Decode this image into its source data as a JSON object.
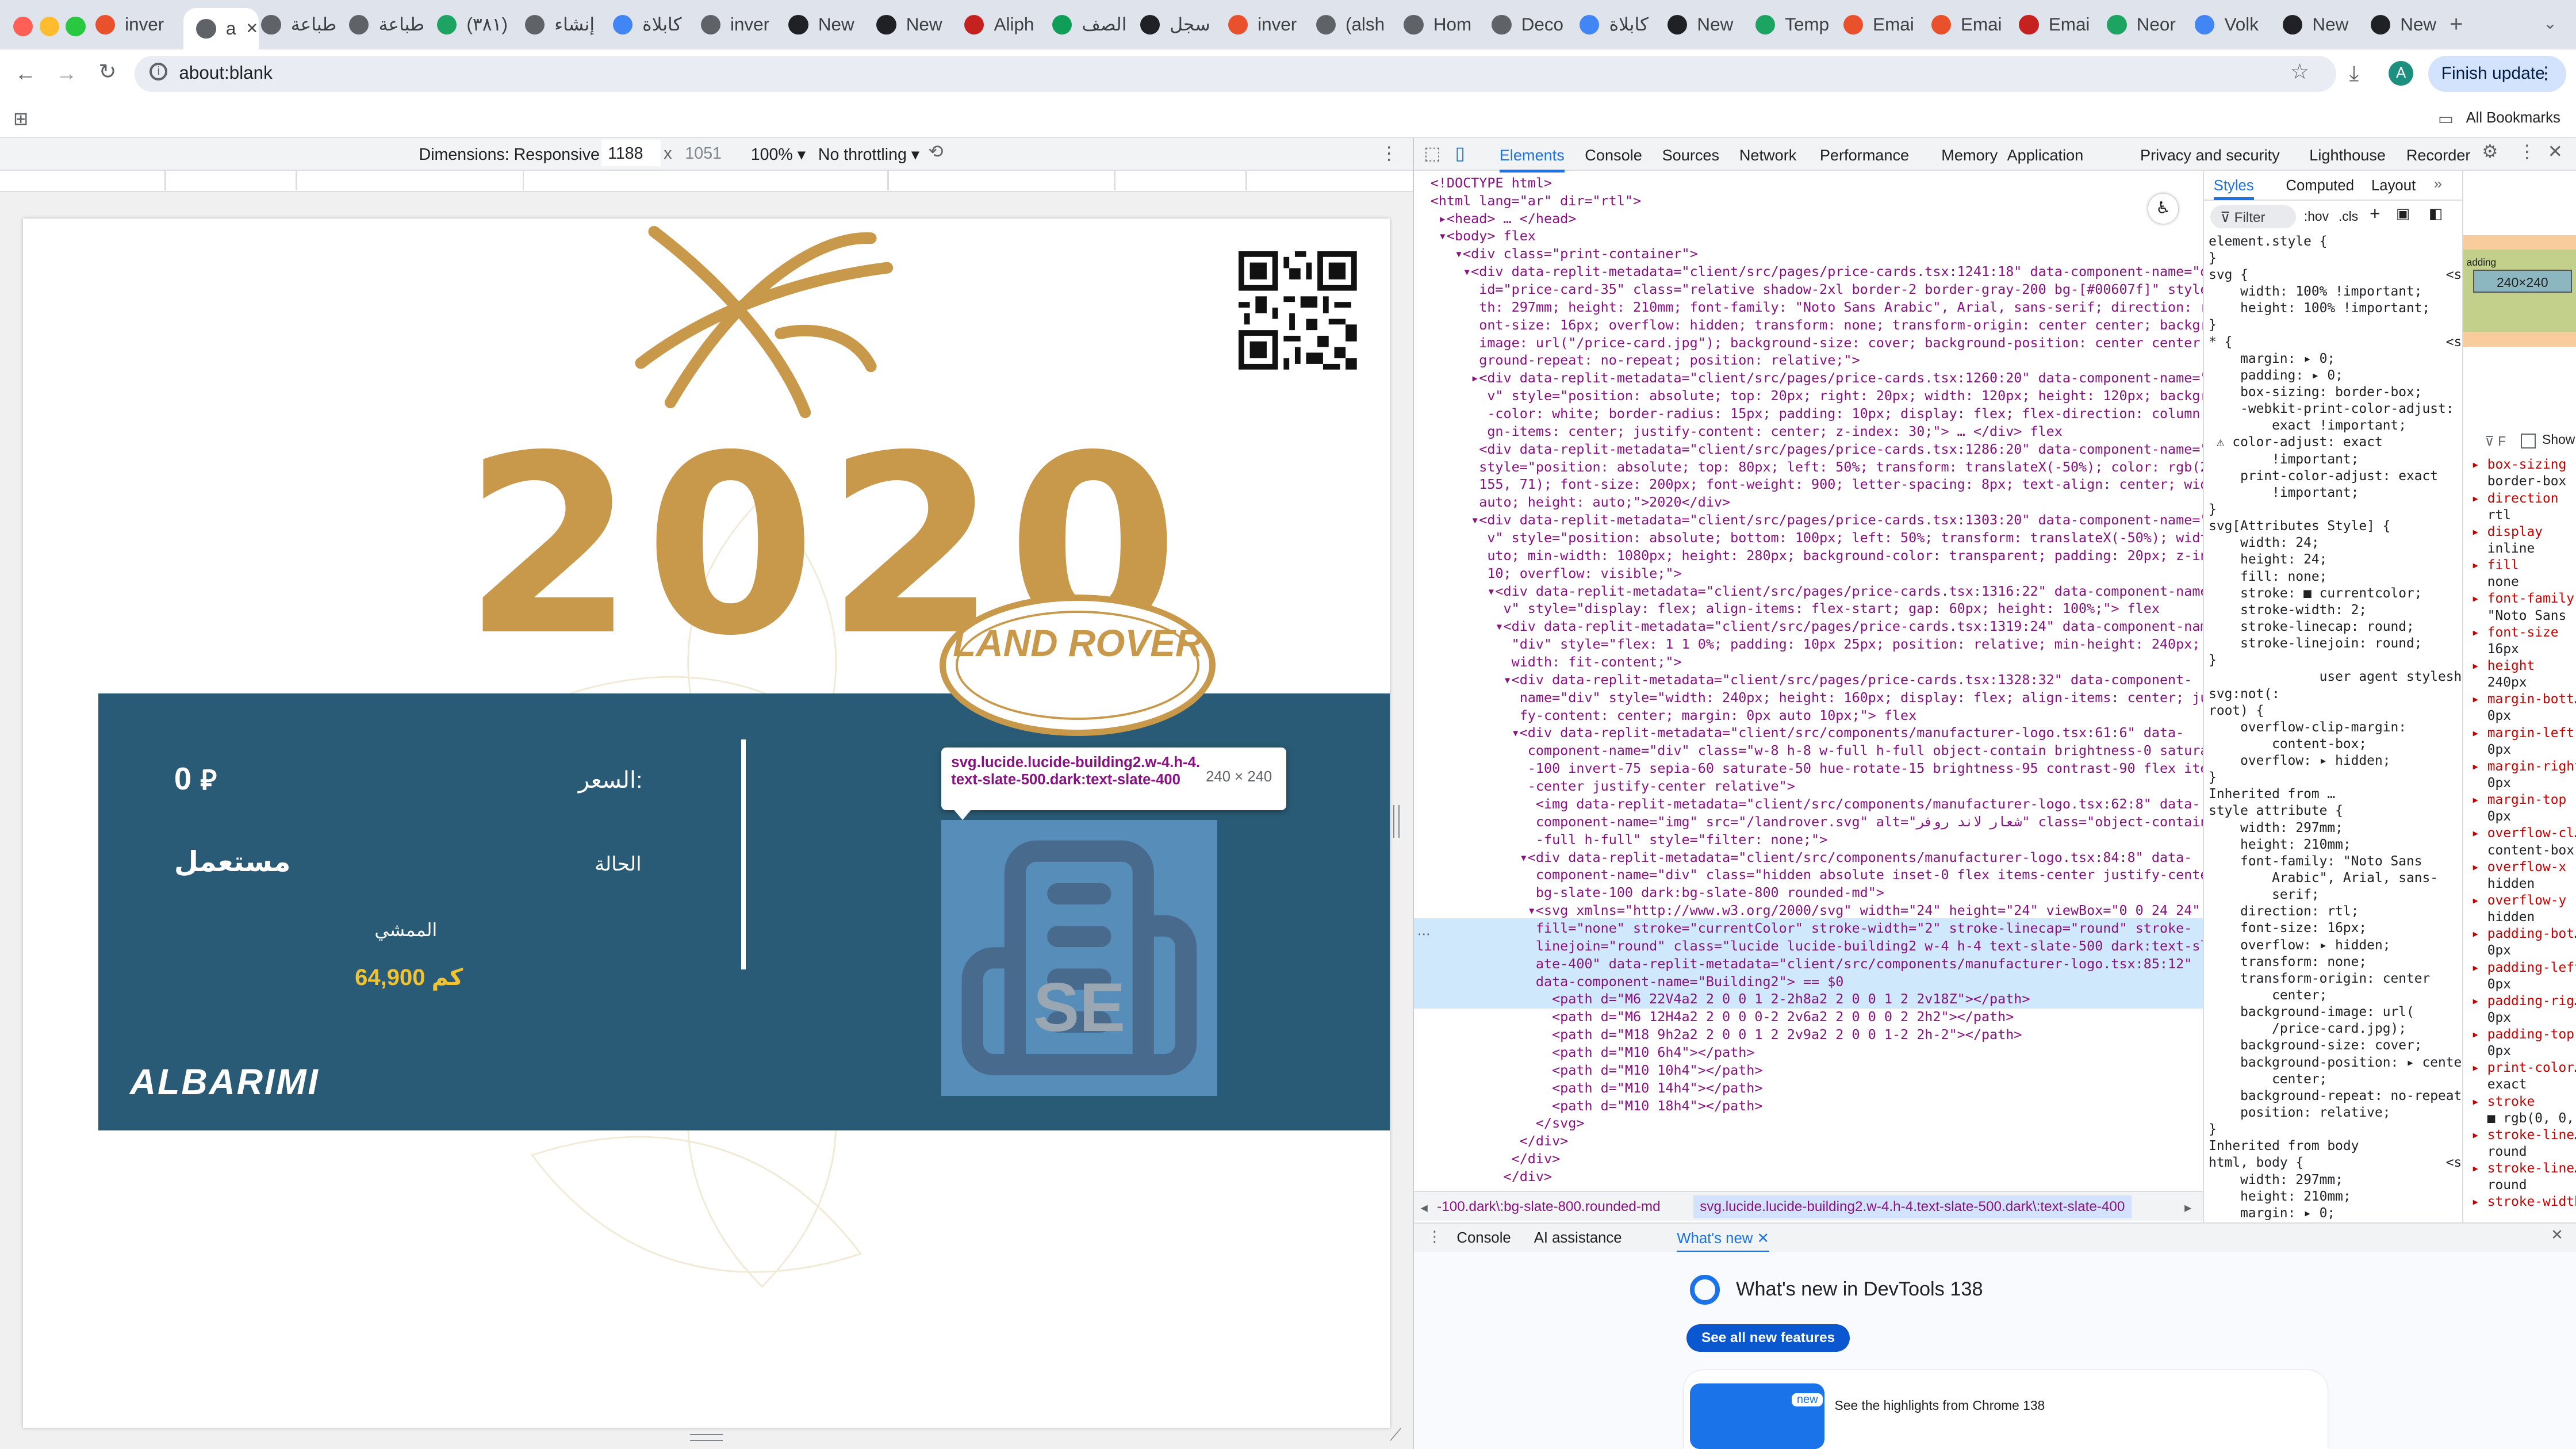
{
  "tabs": [
    {
      "label": "inver",
      "color": "#e8512b"
    },
    {
      "label": "a",
      "color": "#5f6368",
      "active": true
    },
    {
      "label": "طباعة",
      "color": "#5f6368"
    },
    {
      "label": "طباعة",
      "color": "#5f6368"
    },
    {
      "label": "(٣٨١)",
      "color": "#1da462"
    },
    {
      "label": "إنشاء",
      "color": "#5f6368"
    },
    {
      "label": "كابلاة",
      "color": "#4285f4"
    },
    {
      "label": "inver",
      "color": "#5f6368"
    },
    {
      "label": "New",
      "color": "#202124"
    },
    {
      "label": "New",
      "color": "#202124"
    },
    {
      "label": "Aliph",
      "color": "#c5221f"
    },
    {
      "label": "الصف",
      "color": "#0f9d58"
    },
    {
      "label": "سجل",
      "color": "#202124"
    },
    {
      "label": "inver",
      "color": "#e8512b"
    },
    {
      "label": "(alsh",
      "color": "#5f6368"
    },
    {
      "label": "Hom",
      "color": "#5f6368"
    },
    {
      "label": "Deco",
      "color": "#5f6368"
    },
    {
      "label": "كابلاة",
      "color": "#4285f4"
    },
    {
      "label": "New",
      "color": "#202124"
    },
    {
      "label": "Temp",
      "color": "#1da462"
    },
    {
      "label": "Emai",
      "color": "#e8512b"
    },
    {
      "label": "Emai",
      "color": "#e8512b"
    },
    {
      "label": "Emai",
      "color": "#c5221f"
    },
    {
      "label": "Neor",
      "color": "#1da462"
    },
    {
      "label": "Volk",
      "color": "#4285f4"
    },
    {
      "label": "New",
      "color": "#202124"
    },
    {
      "label": "New",
      "color": "#202124"
    }
  ],
  "toolbar": {
    "url": "about:blank",
    "finish_update": "Finish update",
    "profile_initial": "A",
    "all_bookmarks": "All Bookmarks"
  },
  "device": {
    "dimensions_label": "Dimensions: Responsive",
    "width": "1188",
    "x": "x",
    "height": "1051",
    "zoom": "100%",
    "throttle": "No throttling"
  },
  "card": {
    "year": "2020",
    "brand_badge": "LAND ROVER",
    "price_label": "السعر:",
    "price_value": "0",
    "currency_symbol": "⃁",
    "status_label": "الحالة",
    "status_value": "مستعمل",
    "mileage_label": "الممشي",
    "mileage_value": "64,900 كم",
    "dealer_logo": "ALBARIMI",
    "se_text": "SE"
  },
  "tooltip": {
    "selector": "svg.lucide.lucide-building2.w-4.h-4.text-slate-500.dark:text-slate-400",
    "size": "240 × 240"
  },
  "devtools": {
    "tabs": [
      "Elements",
      "Console",
      "Sources",
      "Network",
      "Performance",
      "Memory",
      "Application",
      "Privacy and security",
      "Lighthouse",
      "Recorder"
    ],
    "styles_tabs": [
      "Styles",
      "Computed",
      "Layout"
    ],
    "filter_placeholder": "Filter",
    "hov": ":hov",
    "cls": ".cls",
    "breadcrumb_a": "-100.dark\\:bg-slate-800.rounded-md",
    "breadcrumb_b": "svg.lucide.lucide-building2.w-4.h-4.text-slate-500.dark\\:text-slate-400",
    "drawer_tabs": [
      "Console",
      "AI assistance",
      "What's new"
    ],
    "whats_new_title": "What's new in DevTools 138",
    "see_all": "See all new features",
    "highlights": "See the highlights from Chrome 138",
    "new_badge": "new",
    "show_all": "Show",
    "box_size": "240×240",
    "code_lines": [
      "<!DOCTYPE html>",
      "<html lang=\"ar\" dir=\"rtl\">",
      " ▸<head> … </head>",
      " ▾<body> flex",
      "   ▾<div class=\"print-container\">",
      "    ▾<div data-replit-metadata=\"client/src/pages/price-cards.tsx:1241:18\" data-component-name=\"div\"",
      "      id=\"price-card-35\" class=\"relative shadow-2xl border-2 border-gray-200 bg-[#00607f]\" style=\"wid",
      "      th: 297mm; height: 210mm; font-family: \"Noto Sans Arabic\", Arial, sans-serif; direction: rtl; f",
      "      ont-size: 16px; overflow: hidden; transform: none; transform-origin: center center; background-",
      "      image: url(\"/price-card.jpg\"); background-size: cover; background-position: center center; back",
      "      ground-repeat: no-repeat; position: relative;\">",
      "     ▸<div data-replit-metadata=\"client/src/pages/price-cards.tsx:1260:20\" data-component-name=\"di",
      "       v\" style=\"position: absolute; top: 20px; right: 20px; width: 120px; height: 120px; background",
      "       -color: white; border-radius: 15px; padding: 10px; display: flex; flex-direction: column; ali",
      "       gn-items: center; justify-content: center; z-index: 30;\"> … </div> flex",
      "      <div data-replit-metadata=\"client/src/pages/price-cards.tsx:1286:20\" data-component-name=\"div\"",
      "      style=\"position: absolute; top: 80px; left: 50%; transform: translateX(-50%); color: rgb(207,",
      "      155, 71); font-size: 200px; font-weight: 900; letter-spacing: 8px; text-align: center; width:",
      "      auto; height: auto;\">2020</div>",
      "     ▾<div data-replit-metadata=\"client/src/pages/price-cards.tsx:1303:20\" data-component-name=\"di",
      "       v\" style=\"position: absolute; bottom: 100px; left: 50%; transform: translateX(-50%); width: a",
      "       uto; min-width: 1080px; height: 280px; background-color: transparent; padding: 20px; z-index:",
      "       10; overflow: visible;\">",
      "       ▾<div data-replit-metadata=\"client/src/pages/price-cards.tsx:1316:22\" data-component-name=\"di",
      "         v\" style=\"display: flex; align-items: flex-start; gap: 60px; height: 100%;\"> flex",
      "        ▾<div data-replit-metadata=\"client/src/pages/price-cards.tsx:1319:24\" data-component-name=",
      "          \"div\" style=\"flex: 1 1 0%; padding: 10px 25px; position: relative; min-height: 240px; min-",
      "          width: fit-content;\">",
      "         ▾<div data-replit-metadata=\"client/src/pages/price-cards.tsx:1328:32\" data-component-",
      "           name=\"div\" style=\"width: 240px; height: 160px; display: flex; align-items: center; justi",
      "           fy-content: center; margin: 0px auto 10px;\"> flex",
      "          ▾<div data-replit-metadata=\"client/src/components/manufacturer-logo.tsx:61:6\" data-",
      "            component-name=\"div\" class=\"w-8 h-8 w-full h-full object-contain brightness-0 saturate",
      "            -100 invert-75 sepia-60 saturate-50 hue-rotate-15 brightness-95 contrast-90 flex items",
      "            -center justify-center relative\">",
      "             <img data-replit-metadata=\"client/src/components/manufacturer-logo.tsx:62:8\" data-",
      "             component-name=\"img\" src=\"/landrover.svg\" alt=\"شعار لاند روفر\" class=\"object-contain w",
      "             -full h-full\" style=\"filter: none;\">",
      "           ▾<div data-replit-metadata=\"client/src/components/manufacturer-logo.tsx:84:8\" data-",
      "             component-name=\"div\" class=\"hidden absolute inset-0 flex items-center justify-center",
      "             bg-slate-100 dark:bg-slate-800 rounded-md\">",
      "            ▾<svg xmlns=\"http://www.w3.org/2000/svg\" width=\"24\" height=\"24\" viewBox=\"0 0 24 24\"",
      "             fill=\"none\" stroke=\"currentColor\" stroke-width=\"2\" stroke-linecap=\"round\" stroke-",
      "             linejoin=\"round\" class=\"lucide lucide-building2 w-4 h-4 text-slate-500 dark:text-sl",
      "             ate-400\" data-replit-metadata=\"client/src/components/manufacturer-logo.tsx:85:12\"",
      "             data-component-name=\"Building2\"> == $0",
      "               <path d=\"M6 22V4a2 2 0 0 1 2-2h8a2 2 0 0 1 2 2v18Z\"></path>",
      "               <path d=\"M6 12H4a2 2 0 0 0-2 2v6a2 2 0 0 0 2 2h2\"></path>",
      "               <path d=\"M18 9h2a2 2 0 0 1 2 2v9a2 2 0 0 1-2 2h-2\"></path>",
      "               <path d=\"M10 6h4\"></path>",
      "               <path d=\"M10 10h4\"></path>",
      "               <path d=\"M10 14h4\"></path>",
      "               <path d=\"M10 18h4\"></path>",
      "             </svg>",
      "           </div>",
      "          </div>",
      "         </div>"
    ],
    "style_lines": [
      "element.style {",
      "}",
      "svg {                         <style>",
      "    width: 100% !important;",
      "    height: 100% !important;",
      "}",
      "* {                           <style>",
      "    margin: ▸ 0;",
      "    padding: ▸ 0;",
      "    box-sizing: border-box;",
      "    -webkit-print-color-adjust:",
      "        exact !important;",
      " ⚠ color-adjust: exact",
      "        !important;",
      "    print-color-adjust: exact",
      "        !important;",
      "}",
      "svg[Attributes Style] {",
      "    width: 24;",
      "    height: 24;",
      "    fill: none;",
      "    stroke: ■ currentcolor;",
      "    stroke-width: 2;",
      "    stroke-linecap: round;",
      "    stroke-linejoin: round;",
      "}",
      "              user agent stylesheet",
      "svg:not(:",
      "root) {",
      "    overflow-clip-margin:",
      "        content-box;",
      "    overflow: ▸ hidden;",
      "}",
      "Inherited from …",
      "style attribute {",
      "    width: 297mm;",
      "    height: 210mm;",
      "    font-family: \"Noto Sans",
      "        Arabic\", Arial, sans-",
      "        serif;",
      "    direction: rtl;",
      "    font-size: 16px;",
      "    overflow: ▸ hidden;",
      "    transform: none;",
      "    transform-origin: center",
      "        center;",
      "    background-image: url(",
      "        /price-card.jpg);",
      "    background-size: cover;",
      "    background-position: ▸ center",
      "        center;",
      "    background-repeat: no-repeat;",
      "    position: relative;",
      "}",
      "Inherited from body",
      "html, body {                  <style>",
      "    width: 297mm;",
      "    height: 210mm;",
      "    margin: ▸ 0;"
    ],
    "computed_lines": [
      "box-sizing",
      "border-box",
      "direction",
      "rtl",
      "display",
      "inline",
      "fill",
      "none",
      "font-family",
      "\"Noto Sans",
      "font-size",
      "16px",
      "height",
      "240px",
      "margin-bott…",
      "0px",
      "margin-left",
      "0px",
      "margin-right",
      "0px",
      "margin-top",
      "0px",
      "overflow-cl…",
      "content-box",
      "overflow-x",
      "hidden",
      "overflow-y",
      "hidden",
      "padding-bot…",
      "0px",
      "padding-left",
      "0px",
      "padding-rig…",
      "0px",
      "padding-top",
      "0px",
      "print-color…",
      "exact",
      "stroke",
      "■ rgb(0, 0,",
      "stroke-line…",
      "round",
      "stroke-line…",
      "round",
      "stroke-width"
    ]
  }
}
